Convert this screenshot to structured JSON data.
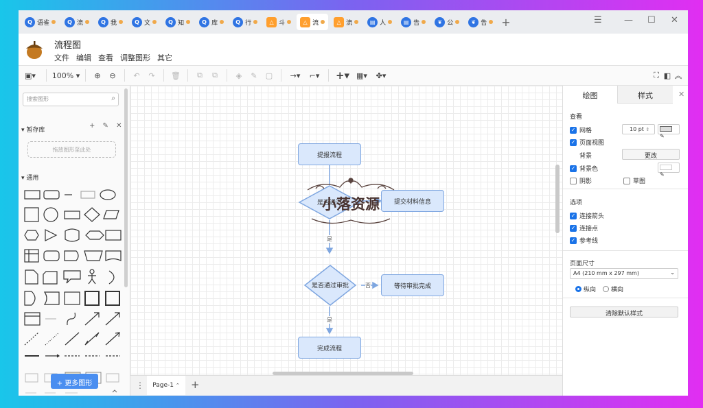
{
  "tabs": [
    {
      "title": "语雀",
      "icon": "q-icon",
      "color": "#2f74e3"
    },
    {
      "title": "流",
      "icon": "q-icon",
      "color": "#2f74e3"
    },
    {
      "title": "我",
      "icon": "q-icon",
      "color": "#2f74e3"
    },
    {
      "title": "文",
      "icon": "q-icon",
      "color": "#2f74e3"
    },
    {
      "title": "知",
      "icon": "q-icon",
      "color": "#2f74e3"
    },
    {
      "title": "库",
      "icon": "q-icon",
      "color": "#2f74e3"
    },
    {
      "title": "行",
      "icon": "q-icon",
      "color": "#2f74e3"
    },
    {
      "title": "斗",
      "icon": "triangle-icon",
      "color": "#ff9f2e"
    },
    {
      "title": "流",
      "icon": "triangle-icon",
      "color": "#ff9f2e"
    },
    {
      "title": "流",
      "icon": "triangle-icon",
      "color": "#ff9f2e"
    },
    {
      "title": "人",
      "icon": "doc-icon",
      "color": "#2f74e3"
    },
    {
      "title": "告",
      "icon": "doc-icon",
      "color": "#2f74e3"
    },
    {
      "title": "公",
      "icon": "leaf-icon",
      "color": "#2f74e3"
    },
    {
      "title": "告",
      "icon": "leaf-icon",
      "color": "#2f74e3"
    }
  ],
  "new_tab": "+",
  "window_controls": {
    "menu": "☰",
    "min": "—",
    "max": "☐",
    "close": "✕"
  },
  "app": {
    "title": "流程图",
    "menu": [
      "文件",
      "编辑",
      "查看",
      "调整图形",
      "其它"
    ]
  },
  "toolbar": {
    "zoom": "100%"
  },
  "left": {
    "search_placeholder": "搜索图形",
    "scratchpad": "暂存库",
    "scratchpad_actions": "+ ✎ ✕",
    "drop_hint": "拖放图形至此处",
    "general": "通用",
    "more_shapes": "+ 更多图形"
  },
  "diagram": {
    "nodes": [
      "提报流程",
      "提交材料信息",
      "是否通过审批",
      "等待审批完成",
      "完成流程"
    ],
    "diamond1": "是否通过",
    "edge_labels": [
      "是",
      "否",
      "是"
    ]
  },
  "watermark": "小落资源",
  "right": {
    "tabs": [
      "绘图",
      "样式"
    ],
    "close": "✕",
    "view_label": "查看",
    "grid": "网格",
    "grid_size": "10 pt",
    "page_view": "页面视图",
    "background": "背景",
    "change_btn": "更改",
    "bg_color": "背景色",
    "shadow": "阴影",
    "sketch": "草图",
    "options_label": "选项",
    "connection_arrows": "连接箭头",
    "connection_points": "连接点",
    "guides": "参考线",
    "paper_size": "页面尺寸",
    "paper_value": "A4 (210 mm x 297 mm)",
    "portrait": "纵向",
    "landscape": "横向",
    "reset_btn": "清除默认样式"
  },
  "bottom": {
    "page": "Page-1",
    "add": "+"
  }
}
